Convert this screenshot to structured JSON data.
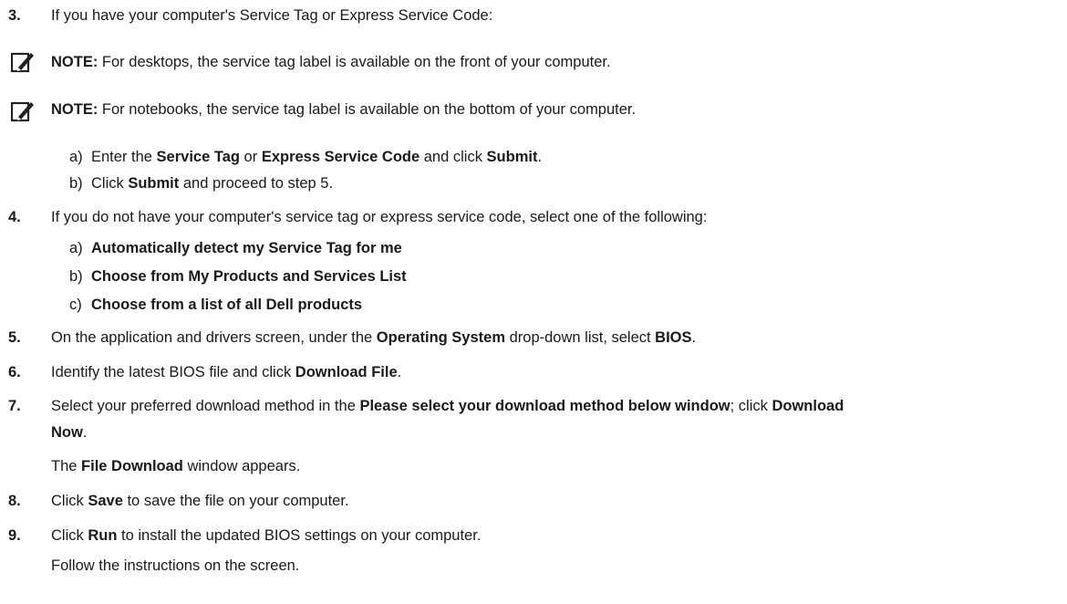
{
  "steps": {
    "s3": {
      "num": "3.",
      "text": "If you have your computer's Service Tag or Express Service Code:"
    },
    "note1": {
      "label": "NOTE:",
      "text": " For desktops, the service tag label is available on the front of your computer."
    },
    "note2": {
      "label": "NOTE:",
      "text": " For notebooks, the service tag label is available on the bottom of your computer."
    },
    "s3a": {
      "lbl": "a)",
      "p1": "Enter the ",
      "b1": "Service Tag",
      "p2": " or ",
      "b2": "Express Service Code",
      "p3": " and click ",
      "b3": "Submit",
      "p4": "."
    },
    "s3b": {
      "lbl": "b)",
      "p1": "Click ",
      "b1": "Submit",
      "p2": " and proceed to step 5."
    },
    "s4": {
      "num": "4.",
      "text": "If you do not have your computer's service tag or express service code, select one of the following:"
    },
    "s4a": {
      "lbl": "a)",
      "b1": "Automatically detect my Service Tag for me"
    },
    "s4b": {
      "lbl": "b)",
      "b1": "Choose from My Products and Services List"
    },
    "s4c": {
      "lbl": "c)",
      "b1": "Choose from a list of all Dell products"
    },
    "s5": {
      "num": "5.",
      "p1": "On the application and drivers screen, under the ",
      "b1": "Operating System",
      "p2": " drop-down list, select ",
      "b2": "BIOS",
      "p3": "."
    },
    "s6": {
      "num": "6.",
      "p1": "Identify the latest BIOS file and click ",
      "b1": "Download File",
      "p2": "."
    },
    "s7": {
      "num": "7.",
      "p1": "Select your preferred download method in the ",
      "b1": "Please select your download method below window",
      "p2": "; click ",
      "b2": "Download",
      "b3": "Now",
      "p3": "."
    },
    "s7r": {
      "p1": "The ",
      "b1": "File Download",
      "p2": " window appears."
    },
    "s8": {
      "num": "8.",
      "p1": "Click ",
      "b1": "Save",
      "p2": " to save the file on your computer."
    },
    "s9": {
      "num": "9.",
      "p1": "Click ",
      "b1": "Run",
      "p2": " to install the updated BIOS settings on your computer."
    },
    "s9r": {
      "text": "Follow the instructions on the screen."
    }
  }
}
